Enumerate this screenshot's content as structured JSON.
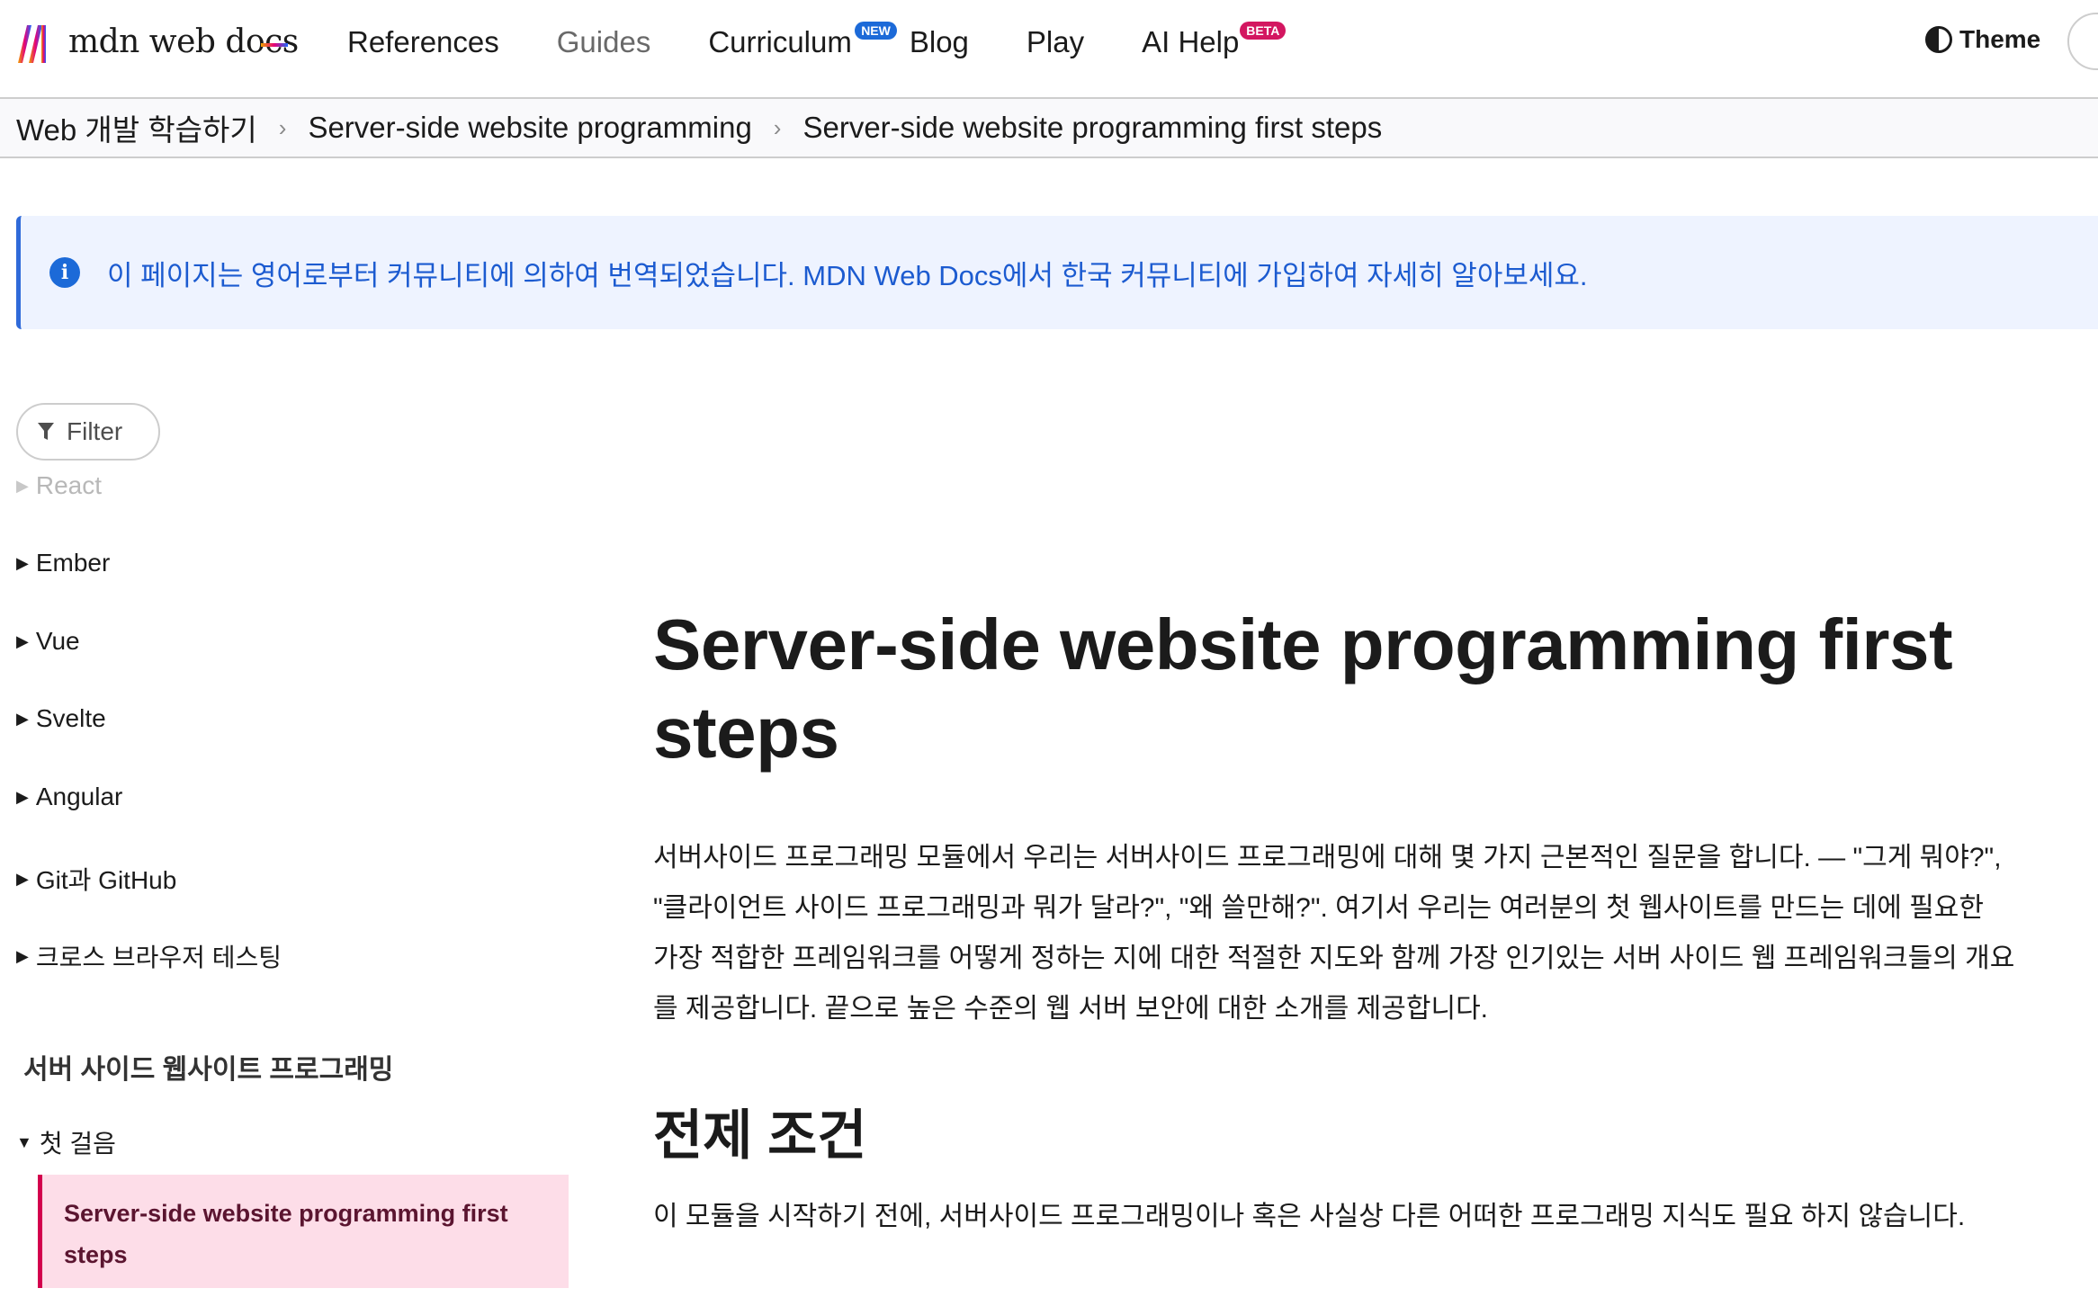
{
  "header": {
    "logo_text": "mdn web docs",
    "nav": [
      {
        "label": "References",
        "muted": false,
        "badge": ""
      },
      {
        "label": "Guides",
        "muted": true,
        "badge": ""
      },
      {
        "label": "Curriculum",
        "muted": false,
        "badge": "NEW"
      },
      {
        "label": "Blog",
        "muted": false,
        "badge": ""
      },
      {
        "label": "Play",
        "muted": false,
        "badge": ""
      },
      {
        "label": "AI Help",
        "muted": false,
        "badge": "BETA"
      }
    ],
    "theme_label": "Theme"
  },
  "breadcrumb": [
    "Web 개발 학습하기",
    "Server-side website programming",
    "Server-side website programming first steps"
  ],
  "notice": {
    "icon": "info-icon",
    "text": "이 페이지는 영어로부터 커뮤니티에 의하여 번역되었습니다. MDN Web Docs에서 한국 커뮤니티에 가입하여 자세히 알아보세요."
  },
  "sidebar": {
    "filter_label": "Filter",
    "items": [
      "React",
      "Ember",
      "Vue",
      "Svelte",
      "Angular",
      "Git과 GitHub",
      "크로스 브라우저 테스팅"
    ],
    "heading": "서버 사이드 웹사이트 프로그래밍",
    "group": "첫 걸음",
    "active_item_lines": [
      "Server-side website programming first",
      "steps"
    ]
  },
  "main": {
    "title_lines": [
      "Server-side website programming first",
      "steps"
    ],
    "intro_lines": [
      "서버사이드 프로그래밍 모듈에서 우리는 서버사이드 프로그래밍에 대해 몇 가지 근본적인 질문을 합니다. — \"그게 뭐야?\",",
      "\"클라이언트 사이드 프로그래밍과 뭐가 달라?\", \"왜 쓸만해?\". 여기서 우리는 여러분의 첫 웹사이트를 만드는 데에 필요한",
      "가장 적합한 프레임워크를 어떻게 정하는 지에 대한 적절한 지도와 함께 가장 인기있는 서버 사이드 웹 프레임워크들의 개요",
      "를 제공합니다. 끝으로 높은 수준의 웹 서버 보안에 대한 소개를 제공합니다."
    ],
    "section_title": "전제 조건",
    "section_text": "이 모듈을 시작하기 전에, 서버사이드 프로그래밍이나 혹은 사실상 다른 어떠한 프로그래밍 지식도 필요 하지 않습니다."
  }
}
